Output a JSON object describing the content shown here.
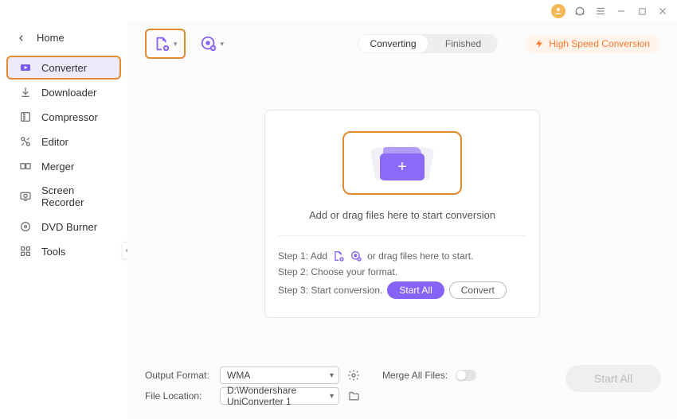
{
  "home_label": "Home",
  "sidebar": {
    "items": [
      {
        "label": "Converter"
      },
      {
        "label": "Downloader"
      },
      {
        "label": "Compressor"
      },
      {
        "label": "Editor"
      },
      {
        "label": "Merger"
      },
      {
        "label": "Screen Recorder"
      },
      {
        "label": "DVD Burner"
      },
      {
        "label": "Tools"
      }
    ]
  },
  "tabs": {
    "converting": "Converting",
    "finished": "Finished"
  },
  "high_speed": "High Speed Conversion",
  "dropzone_text": "Add or drag files here to start conversion",
  "steps": {
    "s1a": "Step 1: Add",
    "s1b": "or drag files here to start.",
    "s2": "Step 2: Choose your format.",
    "s3": "Step 3: Start conversion.",
    "start_all_small": "Start All",
    "convert": "Convert"
  },
  "footer": {
    "output_format_label": "Output Format:",
    "output_format_value": "WMA",
    "file_location_label": "File Location:",
    "file_location_value": "D:\\Wondershare UniConverter 1",
    "merge_label": "Merge All Files:",
    "start_all": "Start All"
  }
}
